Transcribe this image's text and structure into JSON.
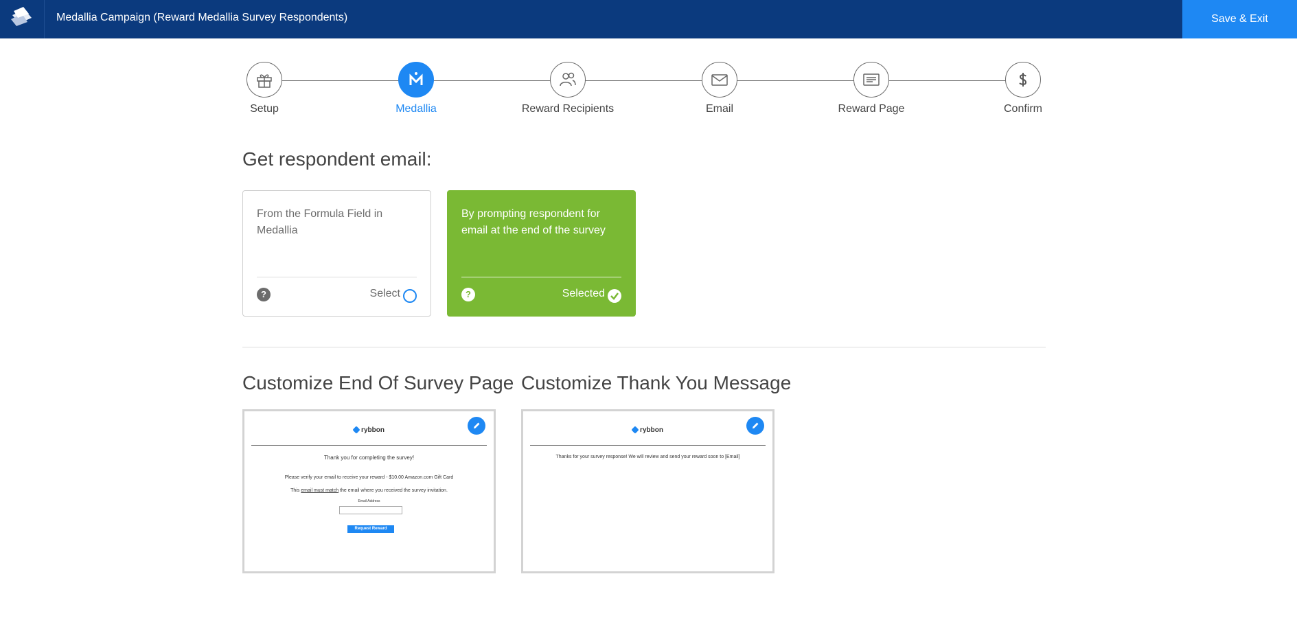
{
  "header": {
    "title": "Medallia Campaign (Reward Medallia Survey Respondents)",
    "save_exit_label": "Save & Exit",
    "logo_icon": "rybbon-logo-icon"
  },
  "stepper": {
    "steps": [
      {
        "label": "Setup",
        "icon": "gift-icon",
        "active": false
      },
      {
        "label": "Medallia",
        "icon": "medallia-icon",
        "active": true
      },
      {
        "label": "Reward Recipients",
        "icon": "users-icon",
        "active": false
      },
      {
        "label": "Email",
        "icon": "envelope-icon",
        "active": false
      },
      {
        "label": "Reward Page",
        "icon": "page-icon",
        "active": false
      },
      {
        "label": "Confirm",
        "icon": "dollar-icon",
        "active": false
      }
    ]
  },
  "respondent_email": {
    "heading": "Get respondent email:",
    "options": [
      {
        "text": "From the Formula Field in Medallia",
        "status_label": "Select",
        "selected": false
      },
      {
        "text": "By prompting respondent for email at the end of the survey",
        "status_label": "Selected",
        "selected": true
      }
    ],
    "help_glyph": "?"
  },
  "customize": {
    "end_of_survey": {
      "heading": "Customize End Of Survey Page",
      "brand": "rybbon",
      "thanks": "Thank you for completing the survey!",
      "verify": "Please verify your email to receive your reward - $10.00 Amazon.com Gift Card",
      "match_prefix": "This ",
      "match_underlined": "email must match",
      "match_suffix": " the email where you received the survey invitation.",
      "email_label": "Email Address",
      "button_label": "Request Reward"
    },
    "thank_you": {
      "heading": "Customize Thank You Message",
      "brand": "rybbon",
      "message": "Thanks for your survey response! We will review and send your reward soon to [Email]"
    }
  },
  "colors": {
    "header_bg": "#0b3a7e",
    "accent": "#1e88f3",
    "selected_green": "#7ab934"
  }
}
